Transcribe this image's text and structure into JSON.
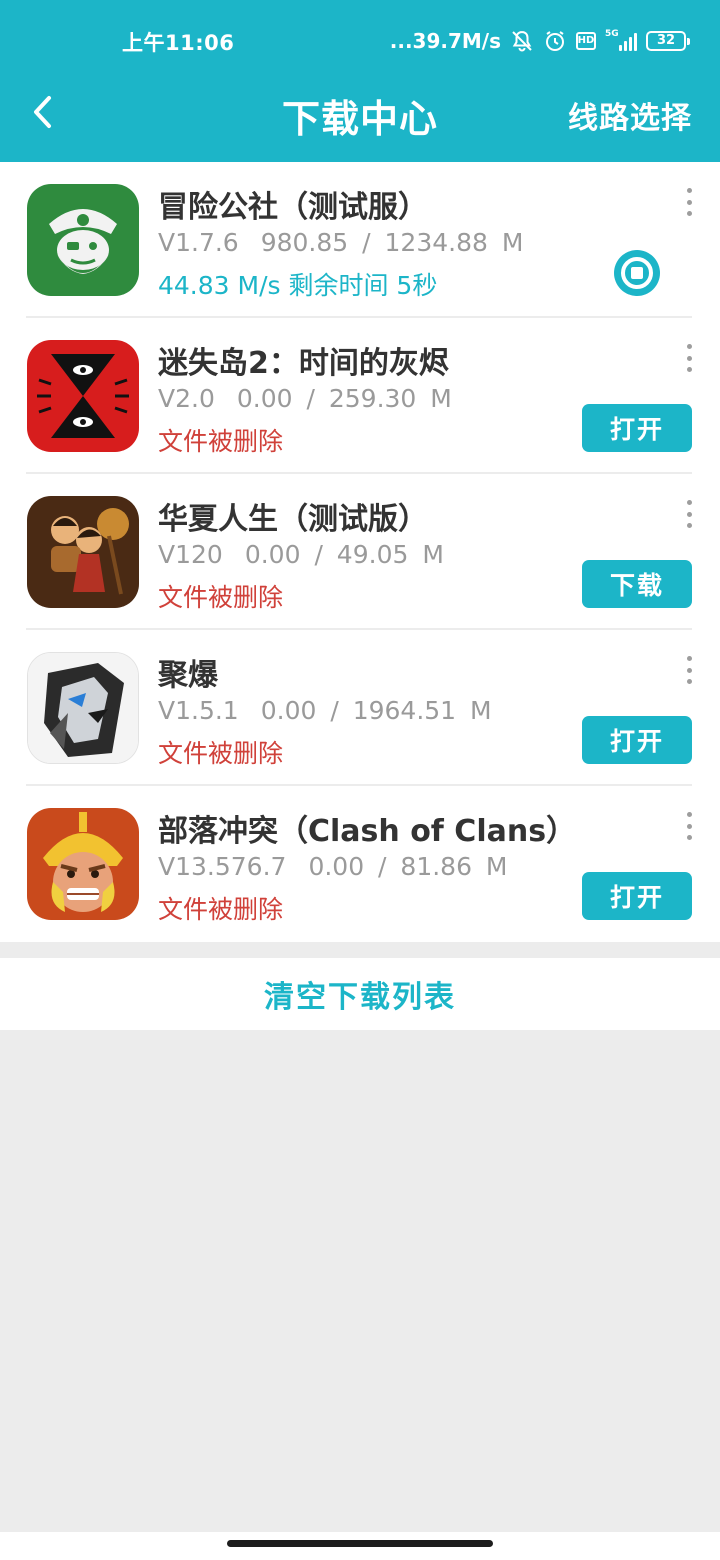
{
  "status_bar": {
    "time": "上午11:06",
    "net_speed": "...39.7M/s",
    "hd_label": "HD",
    "signal_label": "5G",
    "battery": "32"
  },
  "header": {
    "title": "下载中心",
    "route_select": "线路选择"
  },
  "items": [
    {
      "name": "冒险公社（测试服）",
      "version": "V1.7.6",
      "size": "980.85 / 1234.88 M",
      "status": "44.83 M/s  剩余时间 5秒",
      "status_type": "downloading",
      "action": ""
    },
    {
      "name": "迷失岛2：时间的灰烬",
      "version": "V2.0",
      "size": "0.00 / 259.30 M",
      "status": "文件被删除",
      "status_type": "deleted",
      "action": "打开"
    },
    {
      "name": "华夏人生（测试版）",
      "version": "V120",
      "size": "0.00 / 49.05 M",
      "status": "文件被删除",
      "status_type": "deleted",
      "action": "下载"
    },
    {
      "name": "聚爆",
      "version": "V1.5.1",
      "size": "0.00 / 1964.51 M",
      "status": "文件被删除",
      "status_type": "deleted",
      "action": "打开"
    },
    {
      "name": "部落冲突（Clash of Clans）",
      "version": "V13.576.7",
      "size": "0.00 / 81.86 M",
      "status": "文件被删除",
      "status_type": "deleted",
      "action": "打开"
    }
  ],
  "clear_button": "清空下载列表",
  "colors": {
    "accent": "#1cb5c8",
    "deleted": "#d0413a",
    "meta": "#9a9a9a"
  }
}
